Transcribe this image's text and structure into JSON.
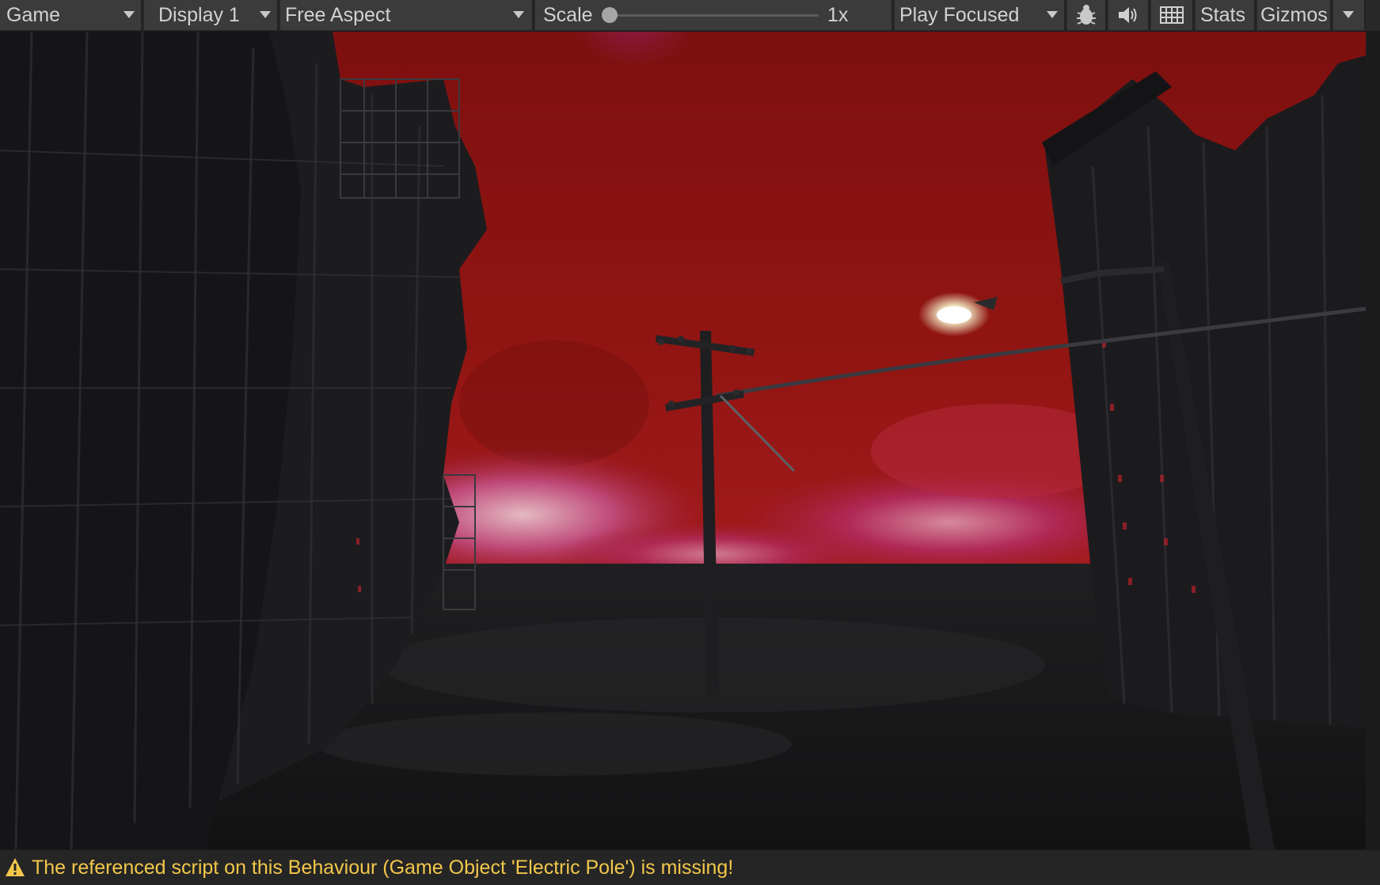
{
  "toolbar": {
    "view_dropdown": "Game",
    "display_dropdown": "Display 1",
    "aspect_dropdown": "Free Aspect",
    "scale_label": "Scale",
    "scale_value": "1x",
    "scale_level": 0,
    "play_mode_dropdown": "Play Focused",
    "stats_label": "Stats",
    "gizmos_label": "Gizmos",
    "icons": [
      "bug-icon",
      "speaker-icon",
      "keyboard-icon"
    ]
  },
  "scene": {
    "description_icon": "game-render"
  },
  "status": {
    "message": "The referenced script on this Behaviour (Game Object 'Electric Pole') is missing!",
    "icon": "warning-icon",
    "color": "#f2c74a"
  },
  "colors": {
    "toolbar_bg": "#282828",
    "cell_bg": "#3b3b3b",
    "sky_red": "#8f1411",
    "sky_pink": "#c4366b"
  }
}
